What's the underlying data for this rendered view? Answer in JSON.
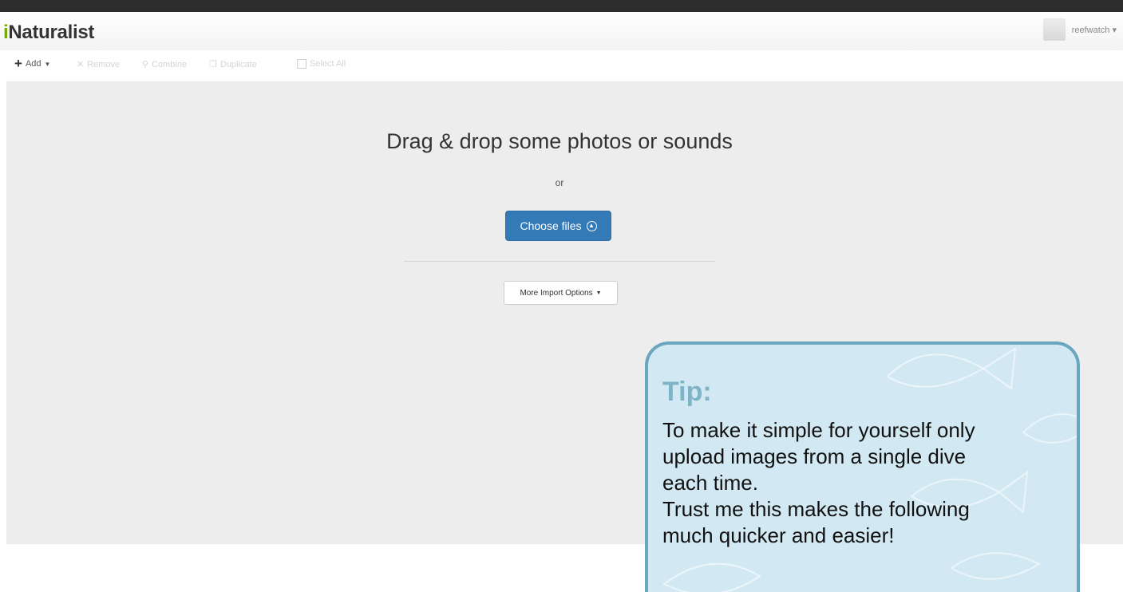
{
  "header": {
    "logo_prefix": "i",
    "logo_rest": "Naturalist",
    "username": "reefwatch"
  },
  "toolbar": {
    "add_label": "Add",
    "remove_label": "Remove",
    "combine_label": "Combine",
    "duplicate_label": "Duplicate",
    "select_all_label": "Select All"
  },
  "uploader": {
    "title": "Drag & drop some photos or sounds",
    "or_text": "or",
    "choose_label": "Choose files",
    "more_options_label": "More Import Options"
  },
  "tip": {
    "title": "Tip:",
    "lines": [
      "To make it simple for yourself only",
      "upload images from a single dive",
      "each time.",
      "Trust me this makes the following",
      "much quicker and easier!"
    ]
  },
  "colors": {
    "brand_green": "#74ac00",
    "primary_blue": "#337ab7",
    "tip_background": "#d2e9f3",
    "tip_border": "#6aa6bd"
  }
}
